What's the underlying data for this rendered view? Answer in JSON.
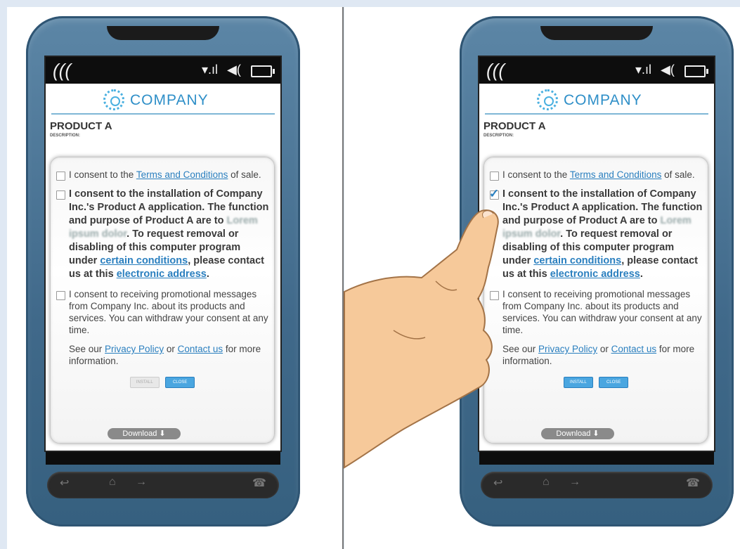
{
  "product": {
    "title": "PRODUCT A",
    "description_label": "DESCRIPTION:"
  },
  "logo_text": "COMPANY",
  "consents": [
    {
      "pre": "I consent to the ",
      "link": "Terms and Conditions",
      "post": " of sale."
    },
    {
      "pre": "I consent to the installation of Company Inc.'s Product A application. The function and purpose of Product A are to ",
      "blur": "Lorem ipsum dolor",
      "mid": ". To request removal or disabling of this computer program under ",
      "link1": "certain conditions",
      "mid2": ", please contact us at this ",
      "link2": "electronic address",
      "post": "."
    },
    {
      "pre": "I consent to receiving promotional messages from Company Inc. about its products and services. You can withdraw your consent at any time."
    }
  ],
  "see": {
    "pre": "See our ",
    "link1": "Privacy Policy",
    "mid": " or ",
    "link2": "Contact us",
    "post": " for more information."
  },
  "buttons": {
    "install": "INSTALL",
    "close": "CLOSE"
  },
  "download": "Download",
  "icons": [
    "wifi-icon",
    "signal-icon",
    "volume-icon",
    "battery-icon",
    "back-icon",
    "home-icon",
    "forward-icon",
    "end-call-icon",
    "download-arrow-icon",
    "checkmark-icon"
  ],
  "colors": {
    "accent": "#2a7fbf",
    "phone_body": "#4a7394",
    "button_active": "#4aa6e0"
  },
  "state": {
    "left_checked": false,
    "right_checked": true
  }
}
